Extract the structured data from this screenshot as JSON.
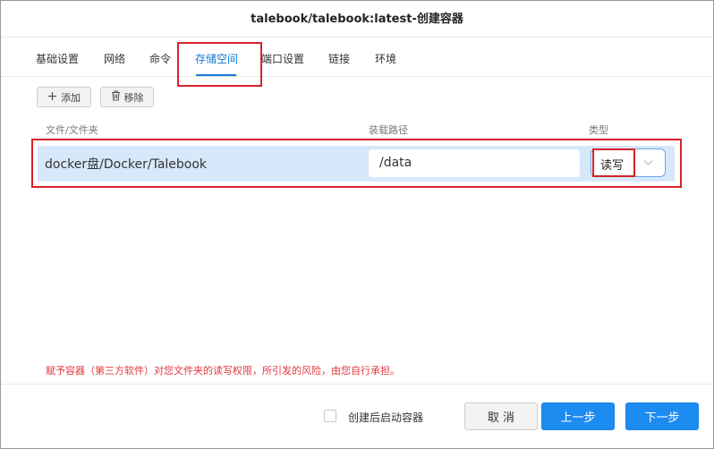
{
  "window": {
    "title": "talebook/talebook:latest-创建容器"
  },
  "tabs": [
    {
      "label": "基础设置"
    },
    {
      "label": "网络"
    },
    {
      "label": "命令"
    },
    {
      "label": "存储空间"
    },
    {
      "label": "端口设置"
    },
    {
      "label": "链接"
    },
    {
      "label": "环境"
    }
  ],
  "active_tab": "存储空间",
  "toolbar": {
    "add_label": "添加",
    "remove_label": "移除"
  },
  "table": {
    "columns": [
      "文件/文件夹",
      "装载路径",
      "类型"
    ],
    "rows": [
      {
        "file": "docker盘/Docker/Talebook",
        "mount_path": "/data",
        "type": "读写"
      }
    ]
  },
  "warning": "赋予容器（第三方软件）对您文件夹的读写权限，所引发的风险，由您自行承担。",
  "footer": {
    "start_after_create_label": "创建后启动容器",
    "start_after_create_checked": false,
    "cancel_label": "取 消",
    "prev_label": "上一步",
    "next_label": "下一步"
  },
  "colors": {
    "accent": "#1478d4",
    "primary_button": "#1d8cf0",
    "selected_row": "#d7e8fb",
    "highlight_box": "#d8232a",
    "warning_text": "#e2373e"
  },
  "icons": {
    "add": "plus-icon",
    "remove": "trash-icon",
    "dropdown": "chevron-down-icon"
  }
}
